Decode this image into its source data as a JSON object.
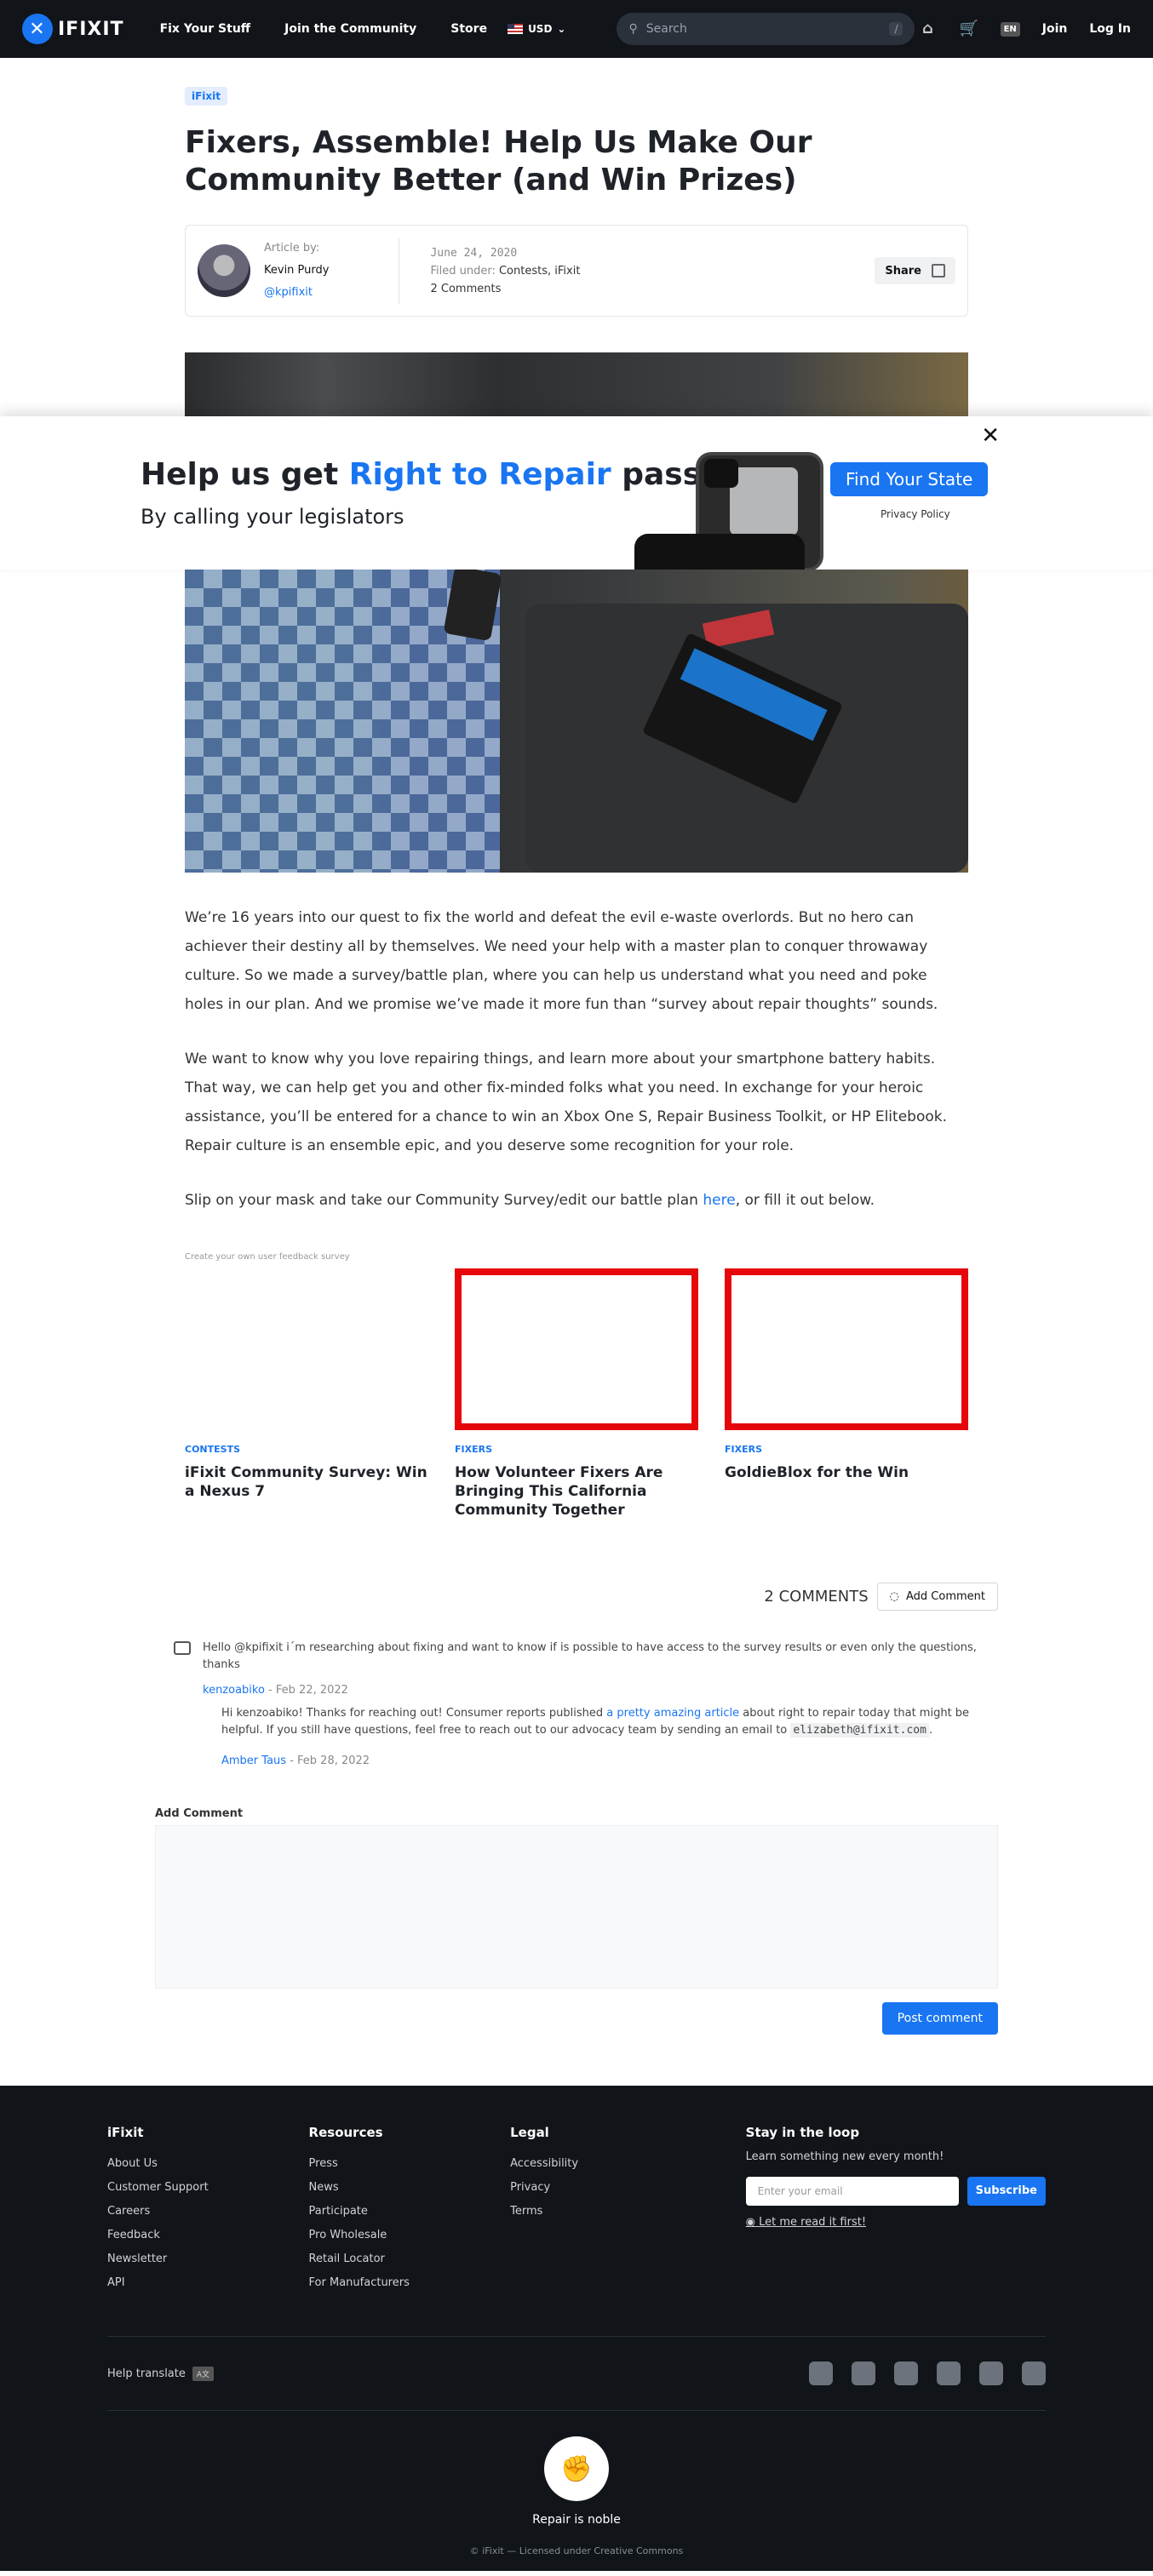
{
  "nav": {
    "logo_text": "IFIXIT",
    "links": [
      "Fix Your Stuff",
      "Join the Community",
      "Store"
    ],
    "currency": "USD",
    "search_placeholder": "Search",
    "search_shortcut": "/",
    "lang": "EN",
    "join": "Join",
    "login": "Log In"
  },
  "article": {
    "tag": "iFixit",
    "title": "Fixers, Assemble! Help Us Make Our Community Better (and Win Prizes)",
    "byline_label": "Article by:",
    "author_name": "Kevin Purdy",
    "author_handle": "@kpifixit",
    "date": "June 24, 2020",
    "filed_label": "Filed under:",
    "filed_value": "Contests, iFixit",
    "comments_count": "2 Comments",
    "share": "Share"
  },
  "banner": {
    "headline_pre": "Help us get ",
    "headline_blue": "Right to Repair",
    "headline_post": " passed",
    "subtitle": "By calling your legislators",
    "cta": "Find Your State",
    "privacy": "Privacy Policy",
    "close": "✕"
  },
  "body": {
    "p1": "We’re 16 years into our quest to fix the world and defeat the evil e-waste overlords. But no hero can achiever their destiny all by themselves. We need your help with a master plan to conquer throwaway culture. So we made a survey/battle plan, where you can help us understand what you need and poke holes in our plan. And we promise we’ve made it more fun than “survey about repair thoughts” sounds.",
    "p2": "We want to know why you love repairing things, and learn more about your smartphone battery habits. That way, we can help get you and other fix-minded folks what you need. In exchange for your heroic assistance, you’ll be entered for a chance to win an Xbox One S, Repair Business Toolkit, or HP Elitebook. Repair culture is an ensemble epic, and you deserve some recognition for your role.",
    "p3_pre": "Slip on your mask and take our Community Survey/edit our battle plan ",
    "p3_link": "here",
    "p3_post": ", or fill it out below.",
    "survey_note": "Create your own user feedback survey"
  },
  "related": [
    {
      "category": "CONTESTS",
      "title": "iFixit Community Survey: Win a Nexus 7"
    },
    {
      "category": "FIXERS",
      "title": "How Volunteer Fixers Are Bringing This California Community Together"
    },
    {
      "category": "FIXERS",
      "title": "GoldieBlox for the Win"
    }
  ],
  "comments": {
    "count_label": "2 COMMENTS",
    "add_button": "Add Comment",
    "c1_text": "Hello @kpifixit i´m researching about fixing and want to know if is possible to have access to the survey results or even only the questions, thanks",
    "c1_author": "kenzoabiko",
    "c1_date": " - Feb 22, 2022",
    "r1_pre": "Hi kenzoabiko! Thanks for reaching out! Consumer reports published ",
    "r1_link": "a pretty amazing article",
    "r1_mid": " about right to repair today that might be helpful. If you still have questions, feel free to reach out to our advocacy team by sending an email to ",
    "r1_email": "elizabeth@ifixit.com",
    "r1_post": ".",
    "r1_author": "Amber Taus",
    "r1_date": " - Feb 28, 2022",
    "form_label": "Add Comment",
    "post_button": "Post comment"
  },
  "footer": {
    "col1_title": "iFixit",
    "col1": [
      "About Us",
      "Customer Support",
      "Careers",
      "Feedback",
      "Newsletter",
      "API"
    ],
    "col2_title": "Resources",
    "col2": [
      "Press",
      "News",
      "Participate",
      "Pro Wholesale",
      "Retail Locator",
      "For Manufacturers"
    ],
    "col3_title": "Legal",
    "col3": [
      "Accessibility",
      "Privacy",
      "Terms"
    ],
    "loop_title": "Stay in the loop",
    "loop_sub": "Learn something new every month!",
    "email_placeholder": "Enter your email",
    "subscribe": "Subscribe",
    "read_first": "Let me read it first!",
    "help_translate": "Help translate",
    "tagline": "Repair is noble",
    "license": "© iFixit — Licensed under Creative Commons"
  },
  "colors": {
    "brand_blue": "#1975f2",
    "nav_bg": "#111419",
    "card_border": "#e6070b"
  }
}
